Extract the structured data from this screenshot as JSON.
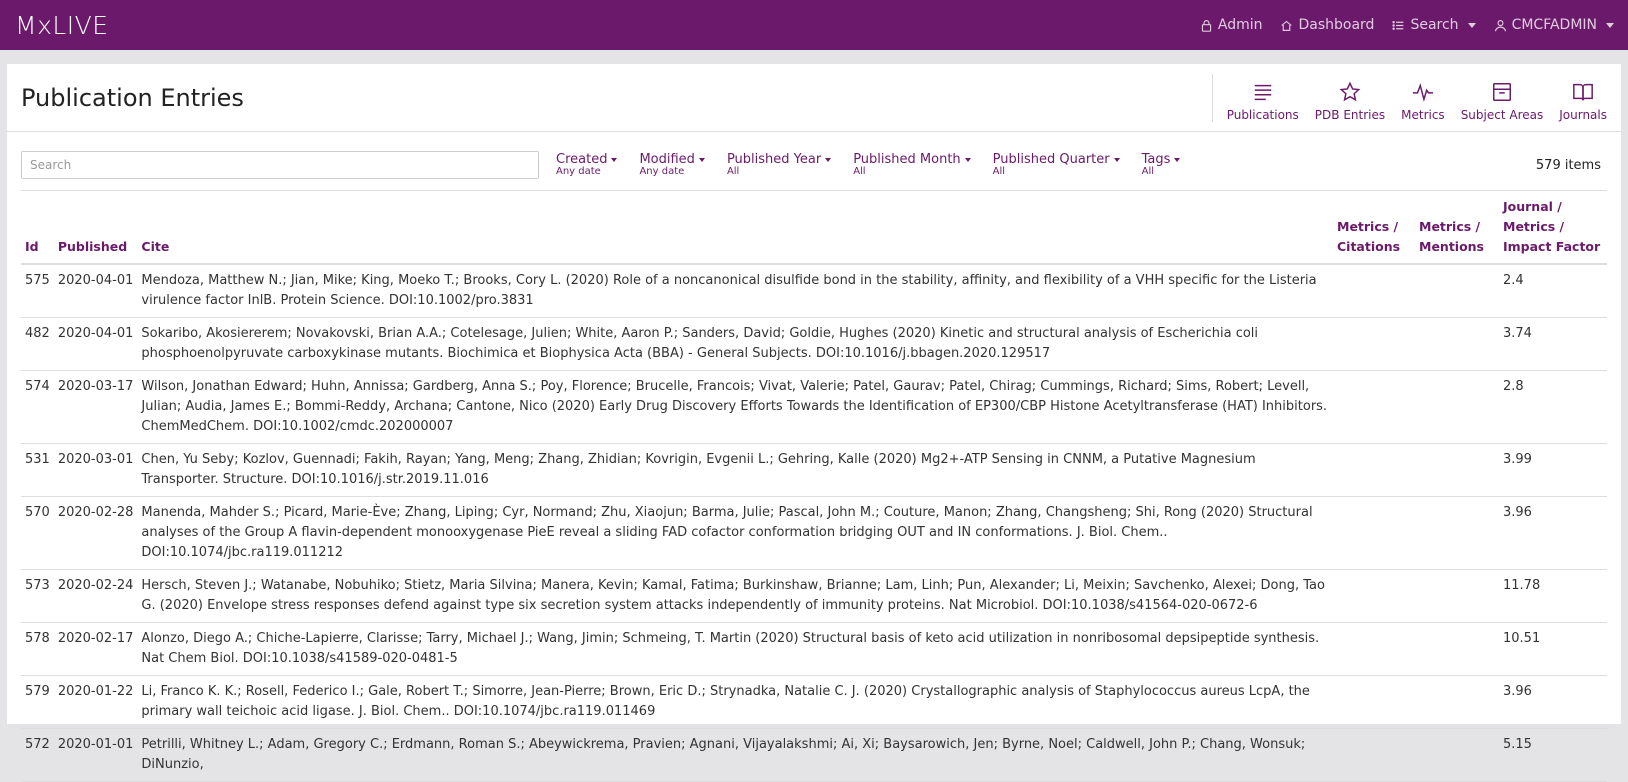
{
  "brand": "MxLIVE",
  "topnav": {
    "admin": "Admin",
    "dashboard": "Dashboard",
    "search": "Search",
    "user": "CMCFADMIN"
  },
  "page": {
    "title": "Publication Entries"
  },
  "tools": [
    {
      "label": "Publications",
      "icon": "list-icon"
    },
    {
      "label": "PDB Entries",
      "icon": "star-icon"
    },
    {
      "label": "Metrics",
      "icon": "pulse-icon"
    },
    {
      "label": "Subject Areas",
      "icon": "archive-icon"
    },
    {
      "label": "Journals",
      "icon": "book-icon"
    }
  ],
  "search": {
    "placeholder": "Search"
  },
  "filters": [
    {
      "label": "Created",
      "value": "Any date"
    },
    {
      "label": "Modified",
      "value": "Any date"
    },
    {
      "label": "Published Year",
      "value": "All"
    },
    {
      "label": "Published Month",
      "value": "All"
    },
    {
      "label": "Published Quarter",
      "value": "All"
    },
    {
      "label": "Tags",
      "value": "All"
    }
  ],
  "item_count": "579 items",
  "table": {
    "headers": {
      "id": "Id",
      "published": "Published",
      "cite": "Cite",
      "citations_1": "Metrics /",
      "citations_2": "Citations",
      "mentions_1": "Metrics /",
      "mentions_2": "Mentions",
      "impact_1": "Journal / Metrics /",
      "impact_2": "Impact Factor"
    },
    "rows": [
      {
        "id": "575",
        "published": "2020-04-01",
        "cite": "Mendoza, Matthew N.; Jian, Mike; King, Moeko T.; Brooks, Cory L. (2020) Role of a noncanonical disulfide bond in the stability, affinity, and flexibility of a VHH specific for the Listeria virulence factor InlB. Protein Science. DOI:10.1002/pro.3831",
        "citations": "",
        "mentions": "",
        "impact": "2.4"
      },
      {
        "id": "482",
        "published": "2020-04-01",
        "cite": "Sokaribo, Akosiererem; Novakovski, Brian A.A.; Cotelesage, Julien; White, Aaron P.; Sanders, David; Goldie, Hughes (2020) Kinetic and structural analysis of Escherichia coli phosphoenolpyruvate carboxykinase mutants. Biochimica et Biophysica Acta (BBA) - General Subjects. DOI:10.1016/j.bbagen.2020.129517",
        "citations": "",
        "mentions": "",
        "impact": "3.74"
      },
      {
        "id": "574",
        "published": "2020-03-17",
        "cite": "Wilson, Jonathan Edward; Huhn, Annissa; Gardberg, Anna S.; Poy, Florence; Brucelle, Francois; Vivat, Valerie; Patel, Gaurav; Patel, Chirag; Cummings, Richard; Sims, Robert; Levell, Julian; Audia, James E.; Bommi-Reddy, Archana; Cantone, Nico (2020) Early Drug Discovery Efforts Towards the Identification of EP300/CBP Histone Acetyltransferase (HAT) Inhibitors. ChemMedChem. DOI:10.1002/cmdc.202000007",
        "citations": "",
        "mentions": "",
        "impact": "2.8"
      },
      {
        "id": "531",
        "published": "2020-03-01",
        "cite": "Chen, Yu Seby; Kozlov, Guennadi; Fakih, Rayan; Yang, Meng; Zhang, Zhidian; Kovrigin, Evgenii L.; Gehring, Kalle (2020) Mg2+-ATP Sensing in CNNM, a Putative Magnesium Transporter. Structure. DOI:10.1016/j.str.2019.11.016",
        "citations": "",
        "mentions": "",
        "impact": "3.99"
      },
      {
        "id": "570",
        "published": "2020-02-28",
        "cite": "Manenda, Mahder S.; Picard, Marie-Ève; Zhang, Liping; Cyr, Normand; Zhu, Xiaojun; Barma, Julie; Pascal, John M.; Couture, Manon; Zhang, Changsheng; Shi, Rong (2020) Structural analyses of the Group A flavin-dependent monooxygenase PieE reveal a sliding FAD cofactor conformation bridging OUT and IN conformations. J. Biol. Chem.. DOI:10.1074/jbc.ra119.011212",
        "citations": "",
        "mentions": "",
        "impact": "3.96"
      },
      {
        "id": "573",
        "published": "2020-02-24",
        "cite": "Hersch, Steven J.; Watanabe, Nobuhiko; Stietz, Maria Silvina; Manera, Kevin; Kamal, Fatima; Burkinshaw, Brianne; Lam, Linh; Pun, Alexander; Li, Meixin; Savchenko, Alexei; Dong, Tao G. (2020) Envelope stress responses defend against type six secretion system attacks independently of immunity proteins. Nat Microbiol. DOI:10.1038/s41564-020-0672-6",
        "citations": "",
        "mentions": "",
        "impact": "11.78"
      },
      {
        "id": "578",
        "published": "2020-02-17",
        "cite": "Alonzo, Diego A.; Chiche-Lapierre, Clarisse; Tarry, Michael J.; Wang, Jimin; Schmeing, T. Martin (2020) Structural basis of keto acid utilization in nonribosomal depsipeptide synthesis. Nat Chem Biol. DOI:10.1038/s41589-020-0481-5",
        "citations": "",
        "mentions": "",
        "impact": "10.51"
      },
      {
        "id": "579",
        "published": "2020-01-22",
        "cite": "Li, Franco K. K.; Rosell, Federico I.; Gale, Robert T.; Simorre, Jean-Pierre; Brown, Eric D.; Strynadka, Natalie C. J. (2020) Crystallographic analysis of Staphylococcus aureus LcpA, the primary wall teichoic acid ligase. J. Biol. Chem.. DOI:10.1074/jbc.ra119.011469",
        "citations": "",
        "mentions": "",
        "impact": "3.96"
      },
      {
        "id": "572",
        "published": "2020-01-01",
        "cite": "Petrilli, Whitney L.; Adam, Gregory C.; Erdmann, Roman S.; Abeywickrema, Pravien; Agnani, Vijayalakshmi; Ai, Xi; Baysarowich, Jen; Byrne, Noel; Caldwell, John P.; Chang, Wonsuk; DiNunzio,",
        "citations": "",
        "mentions": "",
        "impact": "5.15"
      }
    ]
  },
  "colors": {
    "brand": "#6b1a6b",
    "nav_text": "#e0cbe0"
  }
}
